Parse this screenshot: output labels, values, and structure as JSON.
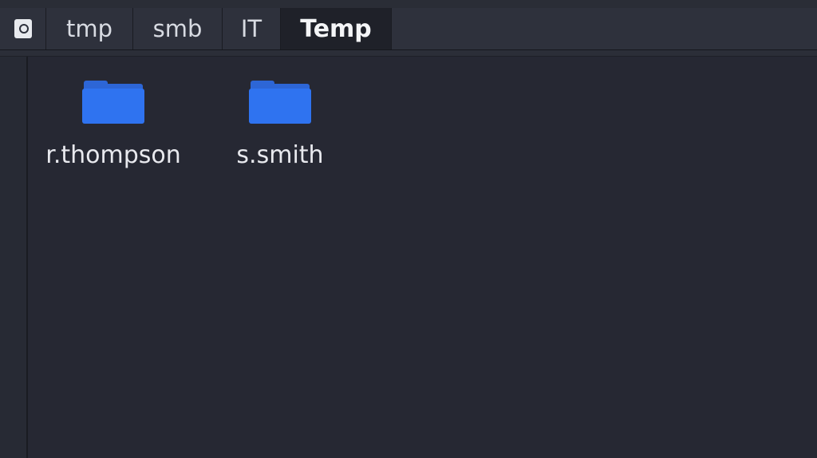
{
  "pathbar": {
    "root_icon": "drive-icon",
    "crumbs": [
      "tmp",
      "smb",
      "IT"
    ],
    "current": "Temp"
  },
  "files": [
    {
      "name": "r.thompson",
      "icon": "folder-icon",
      "color": "#2f73f0"
    },
    {
      "name": "s.smith",
      "icon": "folder-icon",
      "color": "#2f73f0"
    }
  ]
}
